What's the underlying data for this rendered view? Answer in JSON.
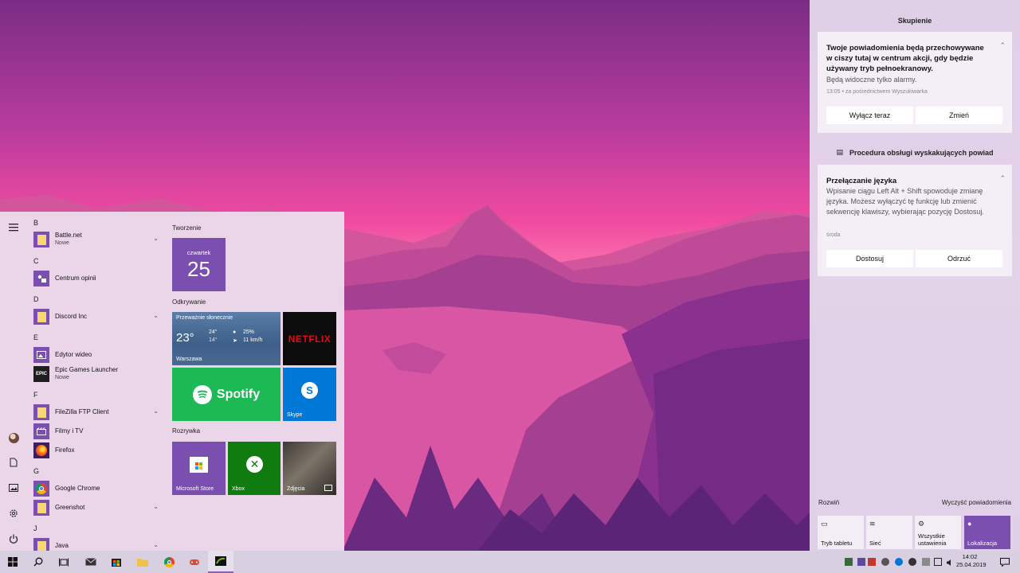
{
  "start_menu": {
    "rail": {
      "hamburger": "hamburger-menu-icon",
      "user": "user-avatar",
      "documents": "documents-icon",
      "pictures": "pictures-icon",
      "settings": "settings-gear-icon",
      "power": "power-icon"
    },
    "app_list": {
      "groups": [
        {
          "letter": "B",
          "apps": [
            {
              "name": "Battle.net",
              "sub": "Nowe",
              "expandable": true
            }
          ]
        },
        {
          "letter": "C",
          "apps": [
            {
              "name": "Centrum opinii",
              "sub": "",
              "expandable": false
            }
          ]
        },
        {
          "letter": "D",
          "apps": [
            {
              "name": "Discord Inc",
              "sub": "",
              "expandable": true
            }
          ]
        },
        {
          "letter": "E",
          "apps": [
            {
              "name": "Edytor wideo",
              "sub": "",
              "expandable": false
            },
            {
              "name": "Epic Games Launcher",
              "sub": "Nowe",
              "expandable": false
            }
          ]
        },
        {
          "letter": "F",
          "apps": [
            {
              "name": "FileZilla FTP Client",
              "sub": "",
              "expandable": true
            },
            {
              "name": "Filmy i TV",
              "sub": "",
              "expandable": false
            },
            {
              "name": "Firefox",
              "sub": "",
              "expandable": false
            }
          ]
        },
        {
          "letter": "G",
          "apps": [
            {
              "name": "Google Chrome",
              "sub": "",
              "expandable": false
            },
            {
              "name": "Greenshot",
              "sub": "",
              "expandable": true
            }
          ]
        },
        {
          "letter": "J",
          "apps": [
            {
              "name": "Java",
              "sub": "",
              "expandable": true
            }
          ]
        }
      ]
    },
    "tiles": {
      "group_creation": "Tworzenie",
      "group_discovery": "Odkrywanie",
      "group_entertainment": "Rozrywka",
      "calendar": {
        "day_name": "czwartek",
        "day_number": "25"
      },
      "weather": {
        "condition": "Przeważnie słonecznie",
        "temp": "23°",
        "high": "24°",
        "low": "14°",
        "humidity": "25%",
        "wind": "11 km/h",
        "city": "Warszawa"
      },
      "netflix": "NETFLIX",
      "spotify": "Spotify",
      "skype": "Skype",
      "store": "Microsoft Store",
      "xbox": "Xbox",
      "photos": "Zdjęcia"
    }
  },
  "action_center": {
    "title": "Skupienie",
    "focus_card": {
      "title": "Twoje powiadomienia będą przechowywane w ciszy tutaj w centrum akcji, gdy będzie używany tryb pełnoekranowy.",
      "body": "Będą widoczne tylko alarmy.",
      "meta": "13:05 • za pośrednictwem Wyszukiwarka",
      "button_primary": "Wyłącz teraz",
      "button_secondary": "Zmień"
    },
    "section_title": "Procedura obsługi wyskakujących powiad",
    "language_card": {
      "title": "Przełączanie języka",
      "body": "Wpisanie ciągu Left Alt + Shift spowoduje zmianę języka. Możesz wyłączyć tę funkcję lub zmienić sekwencję klawiszy, wybierając pozycję Dostosuj.",
      "meta": "środa",
      "button_primary": "Dostosuj",
      "button_secondary": "Odrzuć"
    },
    "expand": "Rozwiń",
    "clear_all": "Wyczyść powiadomienia",
    "quick_actions": [
      {
        "label": "Tryb tabletu",
        "icon": "tablet-mode-icon",
        "active": false
      },
      {
        "label": "Sieć",
        "icon": "network-icon",
        "active": false
      },
      {
        "label": "Wszystkie ustawienia",
        "icon": "settings-gear-icon",
        "active": false
      },
      {
        "label": "Lokalizacja",
        "icon": "location-icon",
        "active": true
      }
    ]
  },
  "taskbar": {
    "clock_time": "14:02",
    "clock_date": "25.04.2019",
    "accent": "#7b4fb0"
  }
}
